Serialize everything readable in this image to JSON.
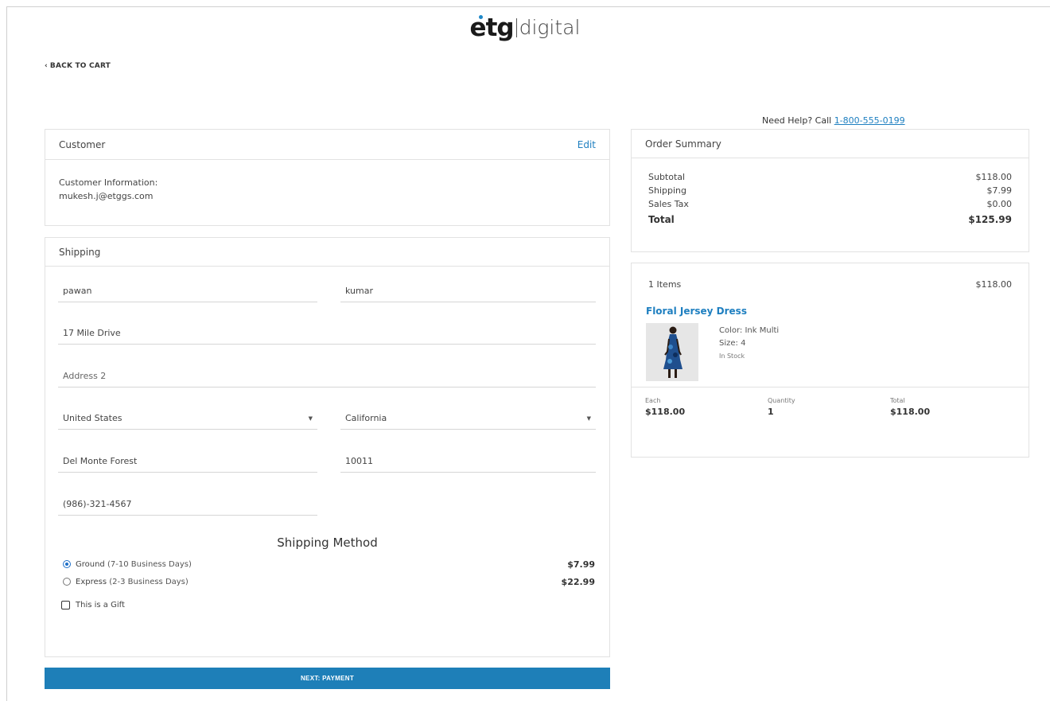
{
  "header": {
    "logo_mark": "etg",
    "logo_word": "digital",
    "back_label": "BACK TO CART",
    "help_text": "Need Help? Call ",
    "help_phone": "1-800-555-0199"
  },
  "customer": {
    "title": "Customer",
    "edit_label": "Edit",
    "info_label": "Customer Information:",
    "email": "mukesh.j@etggs.com"
  },
  "shipping": {
    "title": "Shipping",
    "first_name": "pawan",
    "last_name": "kumar",
    "address1": "17 Mile Drive",
    "address2_placeholder": "Address 2",
    "country": "United States",
    "state": "California",
    "city": "Del Monte Forest",
    "zip": "10011",
    "phone": "(986)-321-4567",
    "method_title": "Shipping Method",
    "methods": [
      {
        "name": "Ground",
        "detail": "(7-10 Business Days)",
        "price": "$7.99",
        "selected": true
      },
      {
        "name": "Express",
        "detail": "(2-3 Business Days)",
        "price": "$22.99",
        "selected": false
      }
    ],
    "gift_label": "This is a Gift",
    "next_label": "NEXT: PAYMENT"
  },
  "summary": {
    "title": "Order Summary",
    "rows": [
      {
        "label": "Subtotal",
        "value": "$118.00"
      },
      {
        "label": "Shipping",
        "value": "$7.99"
      },
      {
        "label": "Sales Tax",
        "value": "$0.00"
      }
    ],
    "total_label": "Total",
    "total_value": "$125.99"
  },
  "items": {
    "count_label": "1 Items",
    "count_total": "$118.00",
    "product_name": "Floral Jersey Dress",
    "color": "Color: Ink Multi",
    "size": "Size: 4",
    "stock": "In Stock",
    "each_label": "Each",
    "each_value": "$118.00",
    "qty_label": "Quantity",
    "qty_value": "1",
    "total_label": "Total",
    "total_value": "$118.00"
  },
  "colors": {
    "accent": "#1e7fb8",
    "link": "#1e7fc0"
  }
}
